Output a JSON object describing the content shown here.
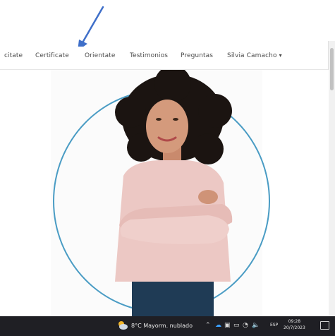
{
  "nav": {
    "items": [
      {
        "label": "citate"
      },
      {
        "label": "Certificate"
      },
      {
        "label": "Orientate"
      },
      {
        "label": "Testimonios"
      },
      {
        "label": "Preguntas"
      },
      {
        "label": "Silvia Camacho"
      }
    ],
    "account_caret_icon": "caret-down-icon"
  },
  "taskbar": {
    "weather": "8°C  Mayorm. nublado",
    "language": "ESP",
    "time": "09:28",
    "date": "20/7/2023"
  },
  "colors": {
    "ring": "#4a9cc4",
    "arrow": "#3f6fc9",
    "taskbar": "#1f1f24"
  }
}
